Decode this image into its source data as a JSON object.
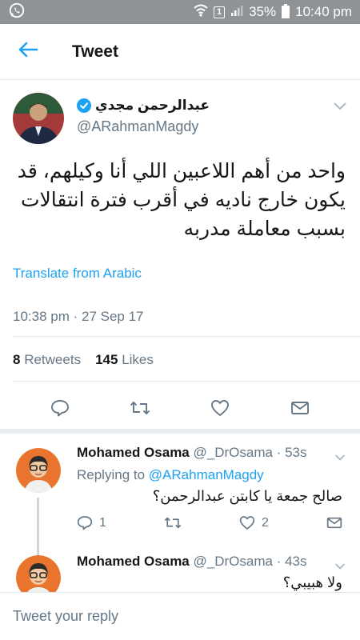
{
  "status_bar": {
    "battery": "35%",
    "time": "10:40 pm",
    "sim_label": "1"
  },
  "header": {
    "title": "Tweet"
  },
  "tweet": {
    "author_name": "عبدالرحمن مجدي",
    "author_handle": "@ARahmanMagdy",
    "text": "واحد من أهم اللاعبين اللي أنا وكيلهم، قد يكون خارج ناديه في أقرب فترة انتقالات بسبب معاملة مدربه",
    "translate_label": "Translate from Arabic",
    "timestamp": "10:38 pm · 27 Sep 17",
    "retweets_count": "8",
    "retweets_label": "Retweets",
    "likes_count": "145",
    "likes_label": "Likes"
  },
  "replies": [
    {
      "name": "Mohamed Osama",
      "handle": "@_DrOsama",
      "age": "53s",
      "replying_prefix": "Replying to",
      "replying_to": "@ARahmanMagdy",
      "text": "صالح جمعة يا كابتن عبدالرحمن؟",
      "reply_count": "1",
      "like_count": "2"
    },
    {
      "name": "Mohamed Osama",
      "handle": "@_DrOsama",
      "age": "43s",
      "text": "ولا هبيبي؟"
    }
  ],
  "composer": {
    "placeholder": "Tweet your reply"
  },
  "colors": {
    "accent": "#1da1f2",
    "secondary_text": "#657786",
    "status_bar": "#8f9396"
  }
}
